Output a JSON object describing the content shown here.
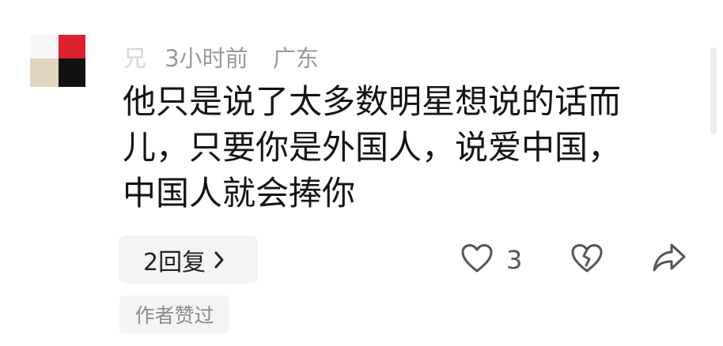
{
  "comment": {
    "avatar_icon": "user-avatar-image",
    "username": "兄",
    "time": "3小时前",
    "location": "广东",
    "text_lines": [
      "他只是说了太多数明星想说的话而",
      "儿，只要你是外国人，说爱中国，",
      "中国人就会捧你"
    ],
    "reply_label": "2回复",
    "like_count": "3",
    "author_badge": "作者赞过"
  },
  "icons": {
    "reply": "chevron-right-icon",
    "like": "heart-outline-icon",
    "dislike": "broken-heart-icon",
    "share": "share-arrow-icon"
  },
  "colors": {
    "text": "#141414",
    "meta": "#9a9a9a",
    "pill_bg": "#f4f4f4",
    "icon_stroke": "#555555",
    "avatar_red": "#d9222b",
    "avatar_black": "#111111",
    "avatar_beige": "#e2d4bd"
  }
}
